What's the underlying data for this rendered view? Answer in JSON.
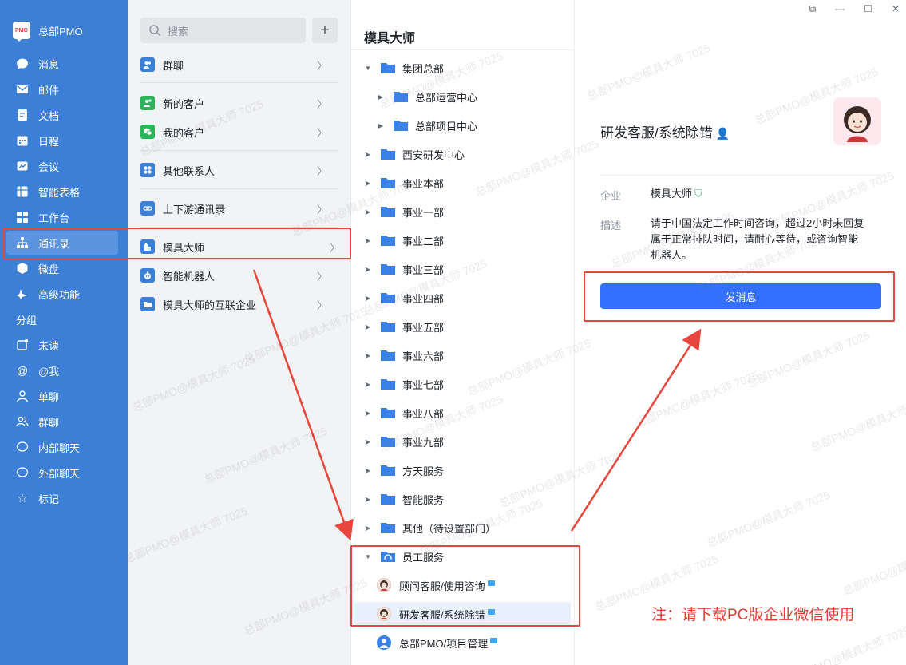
{
  "nav": {
    "brand_logo": "PMO",
    "brand_title": "总部PMO",
    "items": [
      {
        "label": "消息",
        "icon": "chat-icon"
      },
      {
        "label": "邮件",
        "icon": "mail-icon"
      },
      {
        "label": "文档",
        "icon": "doc-icon"
      },
      {
        "label": "日程",
        "icon": "calendar-icon"
      },
      {
        "label": "会议",
        "icon": "meeting-icon"
      },
      {
        "label": "智能表格",
        "icon": "grid-icon"
      },
      {
        "label": "工作台",
        "icon": "workbench-icon"
      },
      {
        "label": "通讯录",
        "icon": "org-icon"
      },
      {
        "label": "微盘",
        "icon": "drive-icon"
      },
      {
        "label": "高级功能",
        "icon": "sparkle-icon"
      }
    ],
    "group_title": "分组",
    "groups": [
      {
        "label": "未读",
        "icon": "unread-icon"
      },
      {
        "label": "@我",
        "icon": "at-icon"
      },
      {
        "label": "单聊",
        "icon": "person-icon"
      },
      {
        "label": "群聊",
        "icon": "group-icon"
      },
      {
        "label": "内部聊天",
        "icon": "chat-icon"
      },
      {
        "label": "外部聊天",
        "icon": "chat-icon"
      },
      {
        "label": "标记",
        "icon": "star-icon"
      }
    ]
  },
  "mid": {
    "search_placeholder": "搜索",
    "add": "+",
    "items": [
      {
        "label": "群聊",
        "color": "#3b7fd6"
      },
      {
        "label": "新的客户",
        "color": "#2bb55b"
      },
      {
        "label": "我的客户",
        "color": "#2bb55b"
      },
      {
        "label": "其他联系人",
        "color": "#3b7fd6"
      },
      {
        "label": "上下游通讯录",
        "color": "#3b7fd6"
      },
      {
        "label": "模具大师",
        "color": "#3b7fd6"
      },
      {
        "label": "智能机器人",
        "color": "#3b7fd6"
      },
      {
        "label": "模具大师的互联企业",
        "color": "#3b7fd6"
      }
    ]
  },
  "tree": {
    "title": "模具大师",
    "nodes": [
      {
        "label": "集团总部",
        "level": 0,
        "arrow": "down"
      },
      {
        "label": "总部运营中心",
        "level": 1,
        "arrow": "right"
      },
      {
        "label": "总部项目中心",
        "level": 1,
        "arrow": "right"
      },
      {
        "label": "西安研发中心",
        "level": 0,
        "arrow": "right"
      },
      {
        "label": "事业本部",
        "level": 0,
        "arrow": "right"
      },
      {
        "label": "事业一部",
        "level": 0,
        "arrow": "right"
      },
      {
        "label": "事业二部",
        "level": 0,
        "arrow": "right"
      },
      {
        "label": "事业三部",
        "level": 0,
        "arrow": "right"
      },
      {
        "label": "事业四部",
        "level": 0,
        "arrow": "right"
      },
      {
        "label": "事业五部",
        "level": 0,
        "arrow": "right"
      },
      {
        "label": "事业六部",
        "level": 0,
        "arrow": "right"
      },
      {
        "label": "事业七部",
        "level": 0,
        "arrow": "right"
      },
      {
        "label": "事业八部",
        "level": 0,
        "arrow": "right"
      },
      {
        "label": "事业九部",
        "level": 0,
        "arrow": "right"
      },
      {
        "label": "方天服务",
        "level": 0,
        "arrow": "right"
      },
      {
        "label": "智能服务",
        "level": 0,
        "arrow": "right"
      },
      {
        "label": "其他（待设置部门）",
        "level": 0,
        "arrow": "right"
      },
      {
        "label": "员工服务",
        "level": 0,
        "arrow": "down"
      }
    ],
    "members": [
      {
        "label": "顾问客服/使用咨询"
      },
      {
        "label": "研发客服/系统除错"
      },
      {
        "label": "总部PMO/项目管理"
      }
    ]
  },
  "detail": {
    "name": "研发客服/系统除错",
    "company_label": "企业",
    "company_value": "模具大师",
    "desc_label": "描述",
    "desc_value": "请于中国法定工作时间咨询，超过2小时未回复属于正常排队时间，请耐心等待，或咨询智能机器人。",
    "send_button": "发消息",
    "note": "注：请下载PC版企业微信使用"
  },
  "window": {
    "controls": [
      "⧉",
      "—",
      "☐",
      "✕"
    ]
  },
  "watermark": "总部PMO@模具大师 7025",
  "colors": {
    "nav_bg": "#3b7fd6",
    "accent": "#3370ff",
    "annotation": "#e8453c"
  }
}
